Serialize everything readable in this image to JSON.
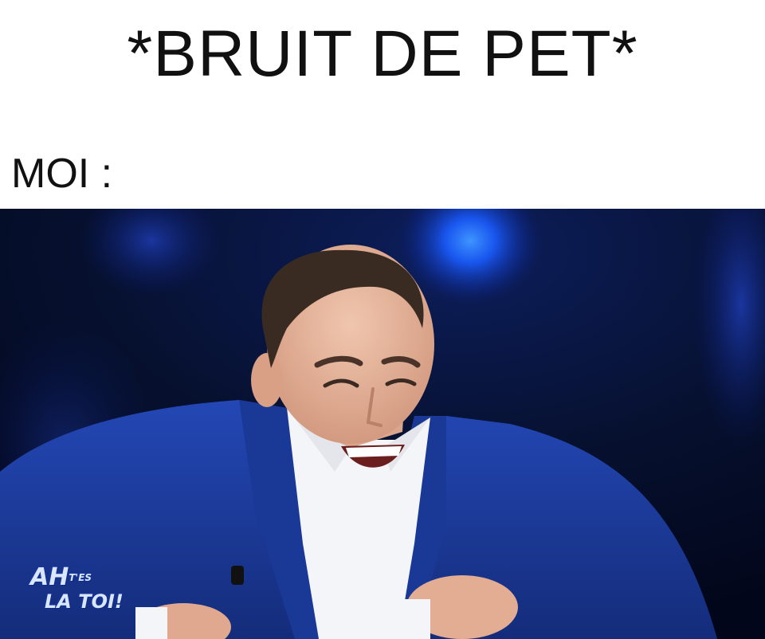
{
  "meme": {
    "headline": "*BRUIT DE PET*",
    "subline": "MOI :"
  },
  "photo": {
    "watermark": {
      "line1_big": "AH",
      "line1_small": "T'ES",
      "line2": "LA TOI!"
    }
  },
  "colors": {
    "caption_text": "#111111",
    "background": "#ffffff",
    "studio_dark": "#050a26",
    "studio_light": "#1a6cff",
    "suit": "#1c3b99",
    "shirt": "#f4f5f8",
    "skin": "#e8b9a0",
    "hair": "#3a2b22"
  }
}
